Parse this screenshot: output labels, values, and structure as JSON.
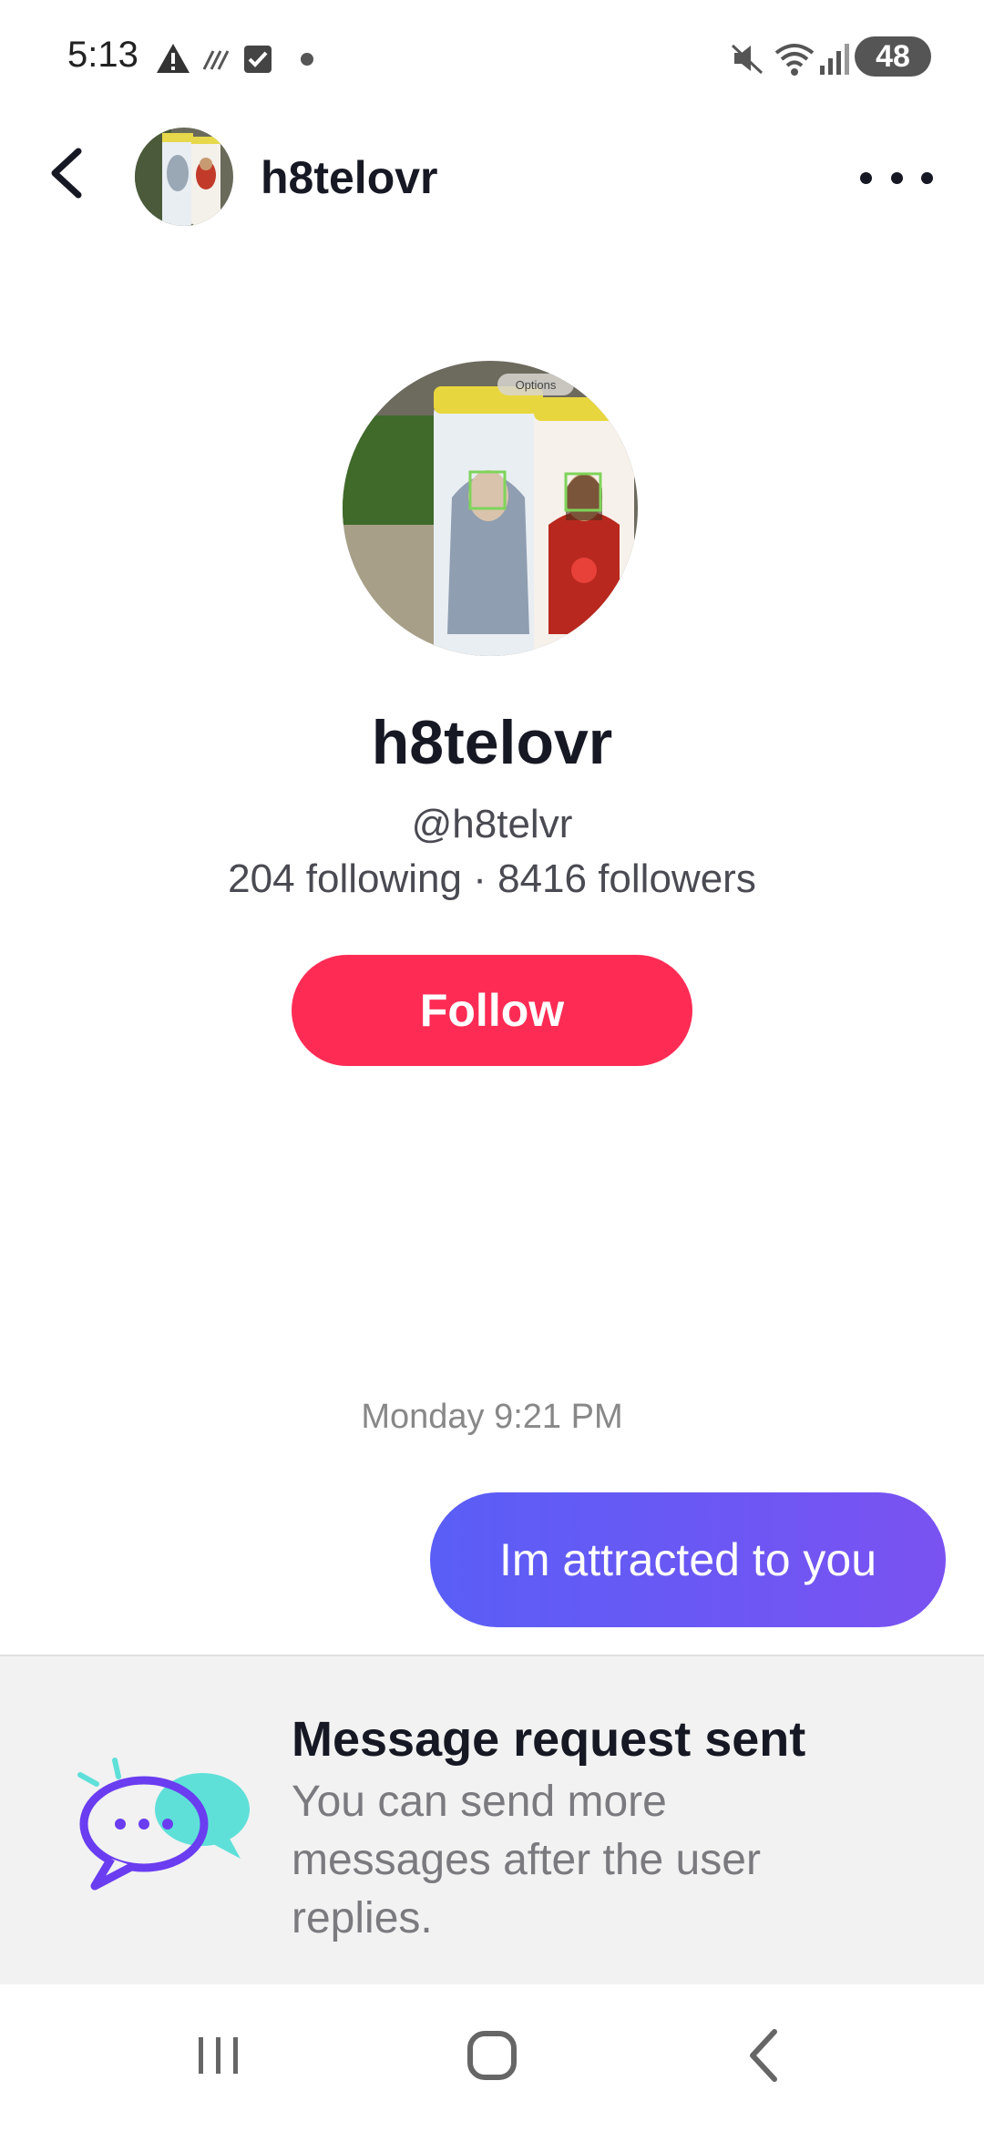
{
  "status_bar": {
    "time": "5:13",
    "battery": "48",
    "icons": [
      "warning-icon",
      "no-sim-icon",
      "checkbox-icon",
      "dot-icon",
      "mute-icon",
      "wifi-icon",
      "signal-icon",
      "battery-icon"
    ]
  },
  "header": {
    "username": "h8telovr",
    "back_icon": "chevron-left-icon",
    "more_icon": "more-horizontal-icon"
  },
  "profile": {
    "name": "h8telovr",
    "handle": "@h8telvr",
    "stats": "204 following · 8416 followers",
    "follow_label": "Follow",
    "avatar_overlay_label": "Options"
  },
  "chat": {
    "timestamp": "Monday 9:21 PM",
    "messages": [
      {
        "text": "Im attracted to you",
        "sender": "me"
      }
    ]
  },
  "notice": {
    "title": "Message request sent",
    "body": "You can send more messages after the user replies."
  },
  "colors": {
    "follow": "#fe2c55",
    "bubble_start": "#5a5ef6",
    "bubble_end": "#7a52f2",
    "notice_bg": "#f2f2f2"
  },
  "navbar": {
    "icons": [
      "recent-apps-icon",
      "home-icon",
      "back-icon"
    ]
  }
}
